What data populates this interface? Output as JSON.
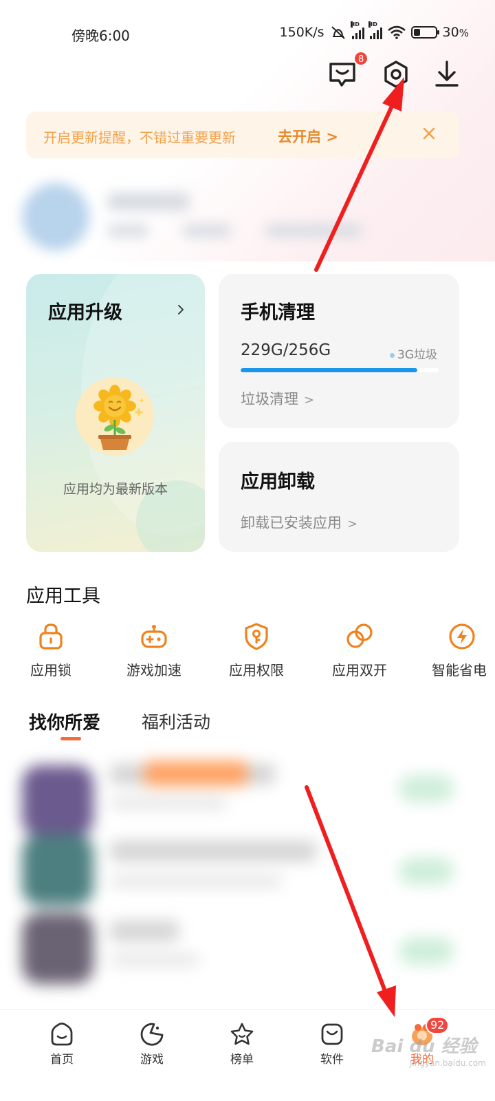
{
  "status_bar": {
    "time": "傍晚6:00",
    "net_speed": "150K/s",
    "battery": "30",
    "battery_unit": "%",
    "battery_level": 0.3
  },
  "header": {
    "message_badge": "8",
    "icons": [
      "message-icon",
      "settings-icon",
      "download-icon"
    ]
  },
  "banner": {
    "text": "开启更新提醒，不错过重要更新",
    "action": "去开启",
    "action_arrow": ">"
  },
  "cards": {
    "upgrade": {
      "title": "应用升级",
      "subtitle": "应用均为最新版本"
    },
    "cleanup": {
      "title": "手机清理",
      "storage": "229G/256G",
      "junk": "3G垃圾",
      "link": "垃圾清理",
      "used_fraction": 0.894
    },
    "uninstall": {
      "title": "应用卸载",
      "link": "卸载已安装应用"
    }
  },
  "tools": {
    "title": "应用工具",
    "items": [
      {
        "label": "应用锁",
        "icon": "lock-icon"
      },
      {
        "label": "游戏加速",
        "icon": "gamepad-icon"
      },
      {
        "label": "应用权限",
        "icon": "shield-key-icon"
      },
      {
        "label": "应用双开",
        "icon": "dual-circle-icon"
      },
      {
        "label": "智能省电",
        "icon": "lightning-icon"
      }
    ]
  },
  "tabs": [
    {
      "label": "找你所爱",
      "active": true
    },
    {
      "label": "福利活动",
      "active": false
    }
  ],
  "bottom_nav": {
    "items": [
      {
        "label": "首页",
        "icon": "home-icon"
      },
      {
        "label": "游戏",
        "icon": "game-icon"
      },
      {
        "label": "榜单",
        "icon": "star-icon"
      },
      {
        "label": "软件",
        "icon": "software-icon"
      },
      {
        "label": "我的",
        "icon": "profile-icon"
      }
    ],
    "profile_badge": "92"
  },
  "watermark": {
    "text": "Bai du 经验",
    "sub": "jingyan.baidu.com"
  },
  "colors": {
    "accent": "#f36a3d",
    "tool_icon": "#f0821e",
    "banner_bg": "#fff4e8",
    "progress": "#1a96ea",
    "badge": "#f2453d",
    "annotation": "#f01f1f"
  }
}
